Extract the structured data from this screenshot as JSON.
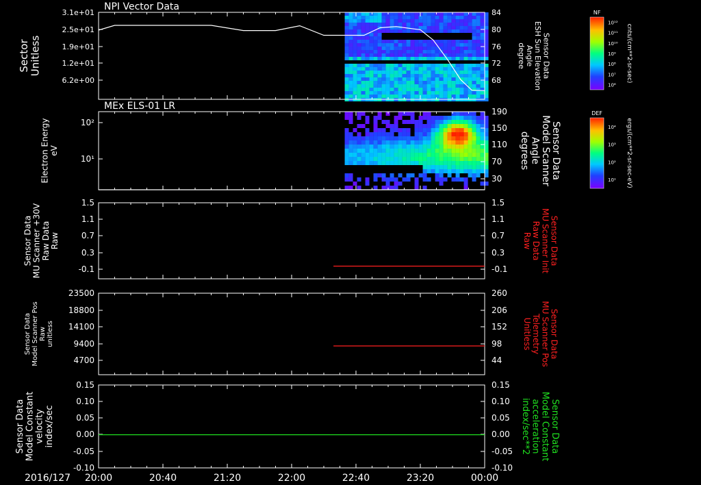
{
  "time_axis": {
    "date_label": "2016/127",
    "ticks": [
      "20:00",
      "20:40",
      "21:20",
      "22:00",
      "22:40",
      "23:20",
      "00:00"
    ],
    "range_minutes": [
      0,
      240
    ]
  },
  "colors": {
    "background": "#000000",
    "axis": "#ffffff",
    "red_trace": "#ff2020",
    "green_trace": "#20e020"
  },
  "colorbars": [
    {
      "tag": "NF",
      "unit": "cnts/(cm**2-sr-sec)",
      "ticks": [
        "10¹²",
        "10¹¹",
        "10¹⁰",
        "10⁹",
        "10⁸",
        "10⁷",
        "10⁶"
      ]
    },
    {
      "tag": "DEF",
      "unit": "ergs/(cm**2-sr-sec-eV)",
      "ticks": [
        "10⁴",
        "10³",
        "10²",
        "10¹"
      ]
    }
  ],
  "chart_data": [
    {
      "type": "heatmap",
      "title": "NPI Vector Data",
      "ylabel": [
        "Sector",
        "Unitless"
      ],
      "yticks": [
        "3.1e+01",
        "2.5e+01",
        "1.9e+01",
        "1.2e+01",
        "6.2e+00"
      ],
      "right_ylabel": [
        "Sensor Data",
        "ESH Sun Elevation",
        "Angle",
        "degree"
      ],
      "right_yticks": [
        "84",
        "80",
        "76",
        "72",
        "68"
      ],
      "right_ylim": [
        62,
        84
      ],
      "spectrogram_start_minute": 153,
      "overlay_line": {
        "name": "Sensor Data ESH Sun Elevation Angle",
        "points": [
          [
            0,
            79.5
          ],
          [
            10,
            80.7
          ],
          [
            50,
            80.7
          ],
          [
            70,
            80.7
          ],
          [
            90,
            79.4
          ],
          [
            110,
            79.4
          ],
          [
            125,
            80.6
          ],
          [
            140,
            78.2
          ],
          [
            155,
            78.2
          ],
          [
            165,
            78.2
          ],
          [
            175,
            80.1
          ],
          [
            185,
            80.4
          ],
          [
            200,
            79.6
          ],
          [
            208,
            77
          ],
          [
            217,
            72
          ],
          [
            225,
            67
          ],
          [
            232,
            64.3
          ],
          [
            240,
            64.2
          ]
        ]
      }
    },
    {
      "type": "heatmap",
      "title": "MEx ELS-01 LR",
      "ylabel": [
        "Electron Energy",
        "eV"
      ],
      "yticks": [
        "10²",
        "10¹"
      ],
      "ylim": [
        1,
        300
      ],
      "yscale": "log",
      "right_ylabel": [
        "Sensor Data",
        "Model Scanner",
        "Angle",
        "degrees"
      ],
      "right_yticks": [
        "190",
        "150",
        "110",
        "70",
        "30"
      ],
      "right_ylim": [
        5,
        190
      ],
      "spectrogram_start_minute": 153,
      "overlay_line": {
        "name": "Sensor Data Model Scanner Angle",
        "points": [
          [
            0,
            5
          ],
          [
            240,
            5
          ]
        ]
      }
    },
    {
      "type": "line",
      "ylabel": [
        "Sensor Data",
        "MU Scanner +30V",
        "Raw Data",
        "Raw"
      ],
      "yticks": [
        "1.5",
        "1.1",
        "0.7",
        "0.3",
        "-0.1"
      ],
      "ylim": [
        -0.3,
        1.5
      ],
      "right_ylabel": [
        "Sensor Data",
        "MU Scanner Init",
        "Raw Data",
        "Raw"
      ],
      "right_yticks": [
        "1.5",
        "1.1",
        "0.7",
        "0.3",
        "-0.1"
      ],
      "right_ylim": [
        -0.3,
        1.5
      ],
      "series": [
        {
          "name": "Sensor Data MU Scanner Init Raw Data",
          "color": "#ff2020",
          "x": [
            146,
            240
          ],
          "values": [
            0.0,
            0.0
          ]
        }
      ]
    },
    {
      "type": "line",
      "ylabel": [
        "Sensor Data",
        "Model Scanner Pos",
        "Raw",
        "unitless"
      ],
      "yticks": [
        "23500",
        "18800",
        "14100",
        "9400",
        "4700"
      ],
      "ylim": [
        0,
        23500
      ],
      "right_ylabel": [
        "Sensor Data",
        "MU Scanner Pos",
        "Telemetry",
        "Unitless"
      ],
      "right_yticks": [
        "260",
        "206",
        "152",
        "98",
        "44"
      ],
      "right_ylim": [
        0,
        260
      ],
      "series": [
        {
          "name": "Sensor Data MU Scanner Pos Telemetry",
          "color": "#ff2020",
          "x": [
            146,
            240
          ],
          "values": [
            8300,
            8300
          ]
        }
      ]
    },
    {
      "type": "line",
      "ylabel": [
        "Sensor Data",
        "Model Constant",
        "velocity",
        "index/sec"
      ],
      "yticks": [
        "0.15",
        "0.10",
        "0.05",
        "0.00",
        "-0.05",
        "-0.10"
      ],
      "ylim": [
        -0.1,
        0.15
      ],
      "right_ylabel": [
        "Sensor Data",
        "Model Constant",
        "acceleration",
        "index/sec**2"
      ],
      "right_yticks": [
        "0.15",
        "0.10",
        "0.05",
        "0.00",
        "-0.05",
        "-0.10"
      ],
      "right_ylim": [
        -0.1,
        0.15
      ],
      "series": [
        {
          "name": "Sensor Data Model Constant velocity",
          "color": "#20e020",
          "x": [
            0,
            240
          ],
          "values": [
            0.0,
            0.0
          ]
        }
      ]
    }
  ]
}
